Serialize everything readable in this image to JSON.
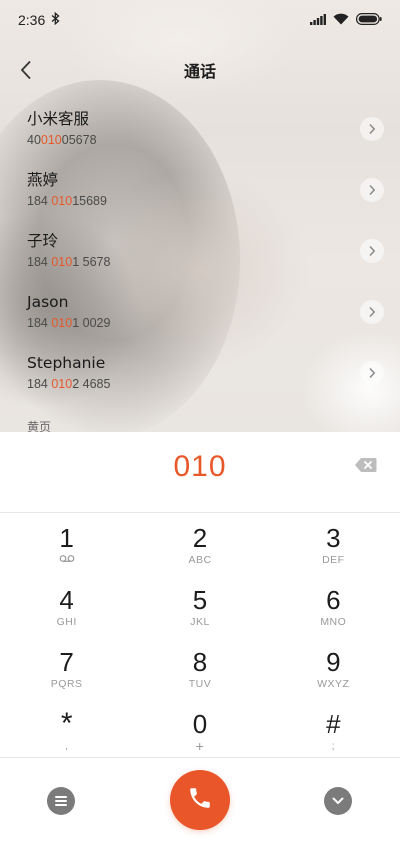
{
  "status": {
    "time": "2:36"
  },
  "header": {
    "title": "通话"
  },
  "contacts": [
    {
      "name": "小米客服",
      "number_pre": "40",
      "number_match": "010",
      "number_post": "05678"
    },
    {
      "name": "燕婷",
      "number_pre": "184 ",
      "number_match": "010",
      "number_post": "15689"
    },
    {
      "name": "子玲",
      "number_pre": "184 ",
      "number_match": "010",
      "number_post": "1 5678"
    },
    {
      "name": "Jason",
      "number_pre": "184 ",
      "number_match": "010",
      "number_post": "1 0029"
    },
    {
      "name": "Stephanie",
      "number_pre": "184 ",
      "number_match": "010",
      "number_post": "2 4685"
    }
  ],
  "section_label": "黄页",
  "dialer": {
    "input": "010",
    "keys": [
      [
        {
          "digit": "1",
          "letters": ""
        },
        {
          "digit": "2",
          "letters": "ABC"
        },
        {
          "digit": "3",
          "letters": "DEF"
        }
      ],
      [
        {
          "digit": "4",
          "letters": "GHI"
        },
        {
          "digit": "5",
          "letters": "JKL"
        },
        {
          "digit": "6",
          "letters": "MNO"
        }
      ],
      [
        {
          "digit": "7",
          "letters": "PQRS"
        },
        {
          "digit": "8",
          "letters": "TUV"
        },
        {
          "digit": "9",
          "letters": "WXYZ"
        }
      ],
      [
        {
          "digit": "*",
          "letters": ","
        },
        {
          "digit": "0",
          "letters": "+"
        },
        {
          "digit": "#",
          "letters": ";"
        }
      ]
    ]
  },
  "colors": {
    "accent": "#e8582a",
    "call_button": "#e8562a",
    "secondary_button": "#7b7b7b"
  },
  "icons": {
    "status_left": "bluetooth-icon",
    "status_right": [
      "signal-icon",
      "wifi-icon",
      "battery-icon"
    ],
    "voicemail": "voicemail-icon",
    "call": "phone-icon",
    "menu": "menu-icon",
    "collapse": "chevron-down-icon",
    "backspace": "backspace-icon",
    "back": "back-arrow-icon",
    "detail": "chevron-right-icon"
  }
}
